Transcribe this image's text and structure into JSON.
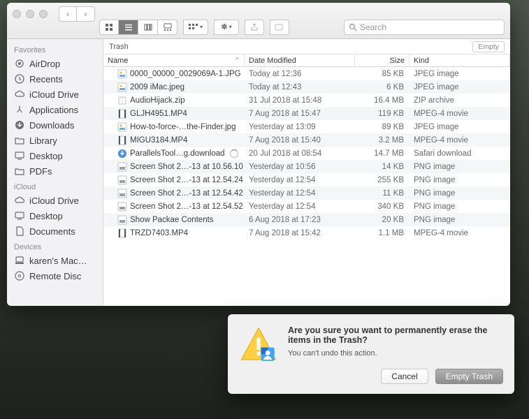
{
  "window": {
    "title": "Trash",
    "path_label": "Trash",
    "empty_button": "Empty",
    "search_placeholder": "Search"
  },
  "toolbar": {
    "back": "‹",
    "forward": "›"
  },
  "sidebar": {
    "sections": [
      {
        "title": "Favorites",
        "items": [
          {
            "label": "AirDrop",
            "icon": "airdrop"
          },
          {
            "label": "Recents",
            "icon": "clock"
          },
          {
            "label": "iCloud Drive",
            "icon": "cloud"
          },
          {
            "label": "Applications",
            "icon": "apps"
          },
          {
            "label": "Downloads",
            "icon": "download"
          },
          {
            "label": "Library",
            "icon": "folder"
          },
          {
            "label": "Desktop",
            "icon": "desktop"
          },
          {
            "label": "PDFs",
            "icon": "folder"
          }
        ]
      },
      {
        "title": "iCloud",
        "items": [
          {
            "label": "iCloud Drive",
            "icon": "cloud"
          },
          {
            "label": "Desktop",
            "icon": "desktop"
          },
          {
            "label": "Documents",
            "icon": "doc"
          }
        ]
      },
      {
        "title": "Devices",
        "items": [
          {
            "label": "karen's Mac…",
            "icon": "mac"
          },
          {
            "label": "Remote Disc",
            "icon": "disc"
          }
        ]
      }
    ]
  },
  "columns": {
    "name": "Name",
    "date": "Date Modified",
    "size": "Size",
    "kind": "Kind"
  },
  "files": [
    {
      "name": "0000_00000_0029069A-1.JPG",
      "date": "Today at 12:36",
      "size": "85 KB",
      "kind": "JPEG image",
      "icon": "jpg"
    },
    {
      "name": "2009 iMac.jpeg",
      "date": "Today at 12:43",
      "size": "6 KB",
      "kind": "JPEG image",
      "icon": "jpg"
    },
    {
      "name": "AudioHijack.zip",
      "date": "31 Jul 2018 at 15:48",
      "size": "16.4 MB",
      "kind": "ZIP archive",
      "icon": "zip"
    },
    {
      "name": "GLJH4951.MP4",
      "date": "7 Aug 2018 at 15:47",
      "size": "119 KB",
      "kind": "MPEG-4 movie",
      "icon": "mov"
    },
    {
      "name": "How-to-force-…the-Finder.jpg",
      "date": "Yesterday at 13:09",
      "size": "89 KB",
      "kind": "JPEG image",
      "icon": "jpg"
    },
    {
      "name": "MIGU3184.MP4",
      "date": "7 Aug 2018 at 15:40",
      "size": "3.2 MB",
      "kind": "MPEG-4 movie",
      "icon": "mov"
    },
    {
      "name": "ParallelsTool…g.download",
      "date": "20 Jul 2018 at 08:54",
      "size": "14.7 MB",
      "kind": "Safari download",
      "icon": "dl",
      "progress": true
    },
    {
      "name": "Screen Shot 2…-13 at 10.56.10",
      "date": "Yesterday at 10:56",
      "size": "14 KB",
      "kind": "PNG image",
      "icon": "png"
    },
    {
      "name": "Screen Shot 2…-13 at 12.54.24",
      "date": "Yesterday at 12:54",
      "size": "255 KB",
      "kind": "PNG image",
      "icon": "png"
    },
    {
      "name": "Screen Shot 2…-13 at 12.54.42",
      "date": "Yesterday at 12:54",
      "size": "11 KB",
      "kind": "PNG image",
      "icon": "png"
    },
    {
      "name": "Screen Shot 2…-13 at 12.54.52",
      "date": "Yesterday at 12:54",
      "size": "340 KB",
      "kind": "PNG image",
      "icon": "png"
    },
    {
      "name": "Show Packae Contents",
      "date": "6 Aug 2018 at 17:23",
      "size": "20 KB",
      "kind": "PNG image",
      "icon": "png"
    },
    {
      "name": "TRZD7403.MP4",
      "date": "7 Aug 2018 at 15:42",
      "size": "1.1 MB",
      "kind": "MPEG-4 movie",
      "icon": "mov"
    }
  ],
  "dialog": {
    "title": "Are you sure you want to permanently erase the items in the Trash?",
    "message": "You can't undo this action.",
    "cancel": "Cancel",
    "confirm": "Empty Trash"
  }
}
